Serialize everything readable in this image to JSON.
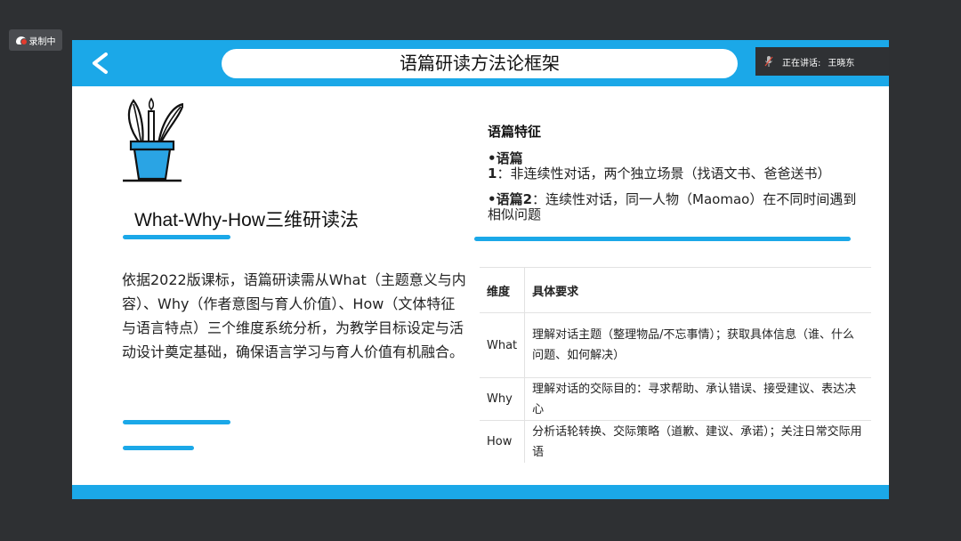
{
  "recording": {
    "label": "录制中"
  },
  "slide": {
    "title": "语篇研读方法论框架",
    "speaker": {
      "prefix": "正在讲话:",
      "name": "王晓东"
    },
    "method_title": "What-Why-How三维研读法",
    "description": "依据2022版课标，语篇研读需从What（主题意义与内容）、Why（作者意图与育人价值）、How（文体特征与语言特点）三个维度系统分析，为教学目标设定与活动设计奠定基础，确保语言学习与育人价值有机融合。",
    "features": {
      "title": "语篇特征",
      "items": [
        {
          "label": "•语篇1",
          "text": "：非连续性对话，两个独立场景（找语文书、爸爸送书）"
        },
        {
          "label": "•语篇2",
          "text": "：连续性对话，同一人物（Maomao）在不同时间遇到相似问题"
        }
      ]
    },
    "table": {
      "headers": [
        "维度",
        "具体要求"
      ],
      "rows": [
        {
          "dim": "What",
          "req": "理解对话主题（整理物品/不忘事情）；获取具体信息（谁、什么问题、如何解决）"
        },
        {
          "dim": "Why",
          "req": "理解对话的交际目的：寻求帮助、承认错误、接受建议、表达决心"
        },
        {
          "dim": "How",
          "req": "分析话轮转换、交际策略（道歉、建议、承诺）；关注日常交际用语"
        }
      ]
    }
  },
  "colors": {
    "accent": "#1ba8e8",
    "background": "#2e3033",
    "pot": "#2aa4e4"
  },
  "icons": [
    "cloud-record-icon",
    "back-arrow-icon",
    "mic-muted-icon",
    "plant-pot-icon"
  ]
}
